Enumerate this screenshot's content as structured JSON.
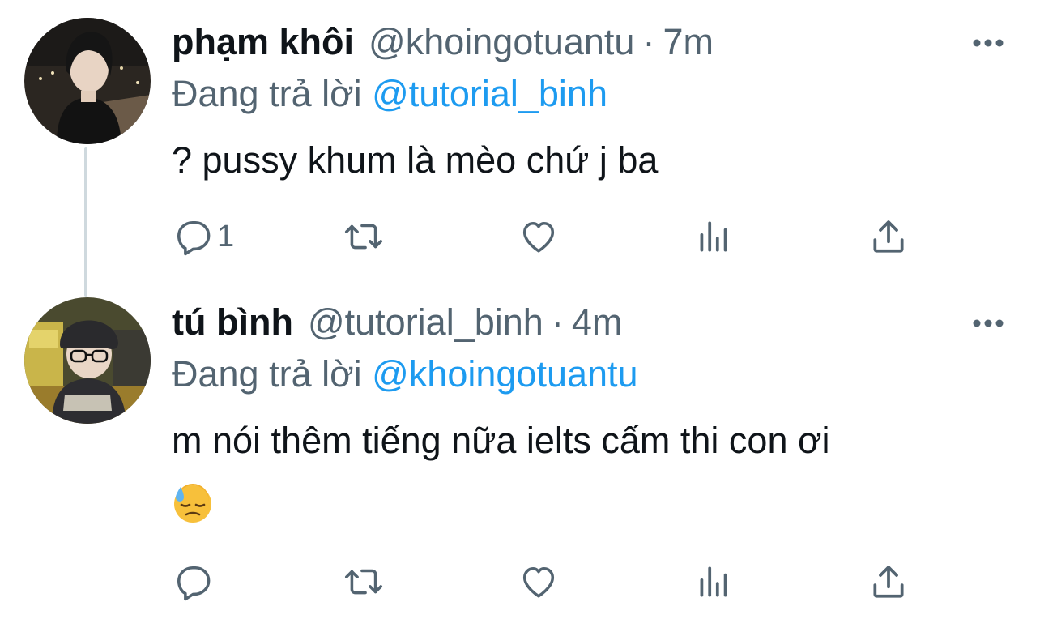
{
  "colors": {
    "text": "#0f1419",
    "secondary": "#536471",
    "link": "#1d9bf0",
    "thread_line": "#cfd9de"
  },
  "tweets": [
    {
      "display_name": "phạm khôi",
      "handle": "@khoingotuantu",
      "separator": "·",
      "time": "7m",
      "reply_prefix": "Đang trả lời",
      "reply_to": "@tutorial_binh",
      "text": "? pussy khum là mèo chứ j ba",
      "reply_count": "1",
      "icons": [
        "reply-icon",
        "retweet-icon",
        "like-icon",
        "analytics-icon",
        "share-icon",
        "more-icon"
      ]
    },
    {
      "display_name": "tú bình",
      "handle": "@tutorial_binh",
      "separator": "·",
      "time": "4m",
      "reply_prefix": "Đang trả lời",
      "reply_to": "@khoingotuantu",
      "text": "m nói thêm tiếng nữa ielts cấm thi con ơi",
      "emoji": "downcast-face-with-sweat",
      "reply_count": "",
      "icons": [
        "reply-icon",
        "retweet-icon",
        "like-icon",
        "analytics-icon",
        "share-icon",
        "more-icon"
      ]
    }
  ]
}
